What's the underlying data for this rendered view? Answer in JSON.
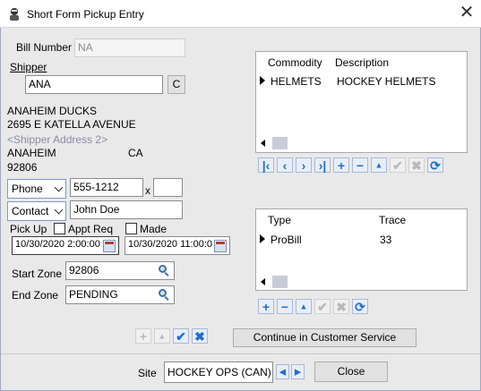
{
  "window": {
    "title": "Short Form Pickup Entry"
  },
  "bill_number": {
    "label": "Bill Number",
    "value": "NA"
  },
  "shipper": {
    "label": "Shipper",
    "code": "ANA",
    "c_button": "C",
    "name": "ANAHEIM DUCKS",
    "address1": "2695 E KATELLA AVENUE",
    "address2_placeholder": "<Shipper Address 2>",
    "city": "ANAHEIM",
    "state": "CA",
    "zip": "92806"
  },
  "phone": {
    "type": "Phone",
    "value": "555-1212",
    "ext_label": "x",
    "ext": ""
  },
  "contact": {
    "type": "Contact",
    "value": "John Doe"
  },
  "pickup": {
    "label": "Pick Up",
    "appt_label": "Appt Req",
    "made_label": "Made",
    "date1": "10/30/2020 2:00:00",
    "date2": "10/30/2020 11:00:0"
  },
  "start_zone": {
    "label": "Start Zone",
    "value": "92806"
  },
  "end_zone": {
    "label": "End Zone",
    "value": "PENDING"
  },
  "commodity_grid": {
    "headers": [
      "Commodity",
      "Description"
    ],
    "rows": [
      {
        "commodity": "HELMETS",
        "description": "HOCKEY HELMETS"
      }
    ],
    "scroll_left": "<"
  },
  "trace_grid": {
    "headers": [
      "Type",
      "Trace"
    ],
    "rows": [
      {
        "type": "ProBill",
        "trace": "33"
      }
    ],
    "scroll_left": "<"
  },
  "buttons": {
    "continue": "Continue in Customer Service",
    "close": "Close"
  },
  "site": {
    "label": "Site",
    "value": "HOCKEY OPS (CAN)"
  },
  "colors": {
    "accent": "#1f6fd1",
    "selection": "#0078d7"
  }
}
